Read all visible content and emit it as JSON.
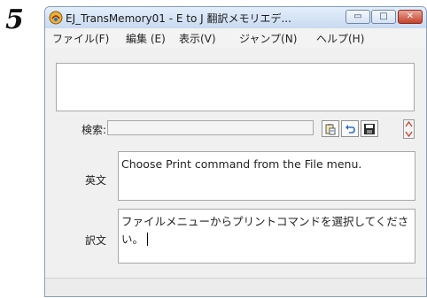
{
  "step_number": "5",
  "window": {
    "title": "EJ_TransMemory01 - E to J 翻訳メモリエデ...",
    "controls": {
      "minimize": "▭",
      "maximize": "□",
      "close": "✕"
    }
  },
  "menu": {
    "file": "ファイル(F)",
    "edit": "編集 (E)",
    "view": "表示(V)",
    "jump": "ジャンプ(N)",
    "help": "ヘルプ(H)"
  },
  "search": {
    "label": "検索:",
    "value": ""
  },
  "fields": {
    "english_label": "英文",
    "english_text": "Choose Print command from the File menu.",
    "japanese_label": "訳文",
    "japanese_text": "ファイルメニューからプリントコマンドを選択してください。"
  },
  "colors": {
    "accent": "#2f6fc7",
    "close": "#c3432d",
    "warning": "#e8b13a"
  }
}
